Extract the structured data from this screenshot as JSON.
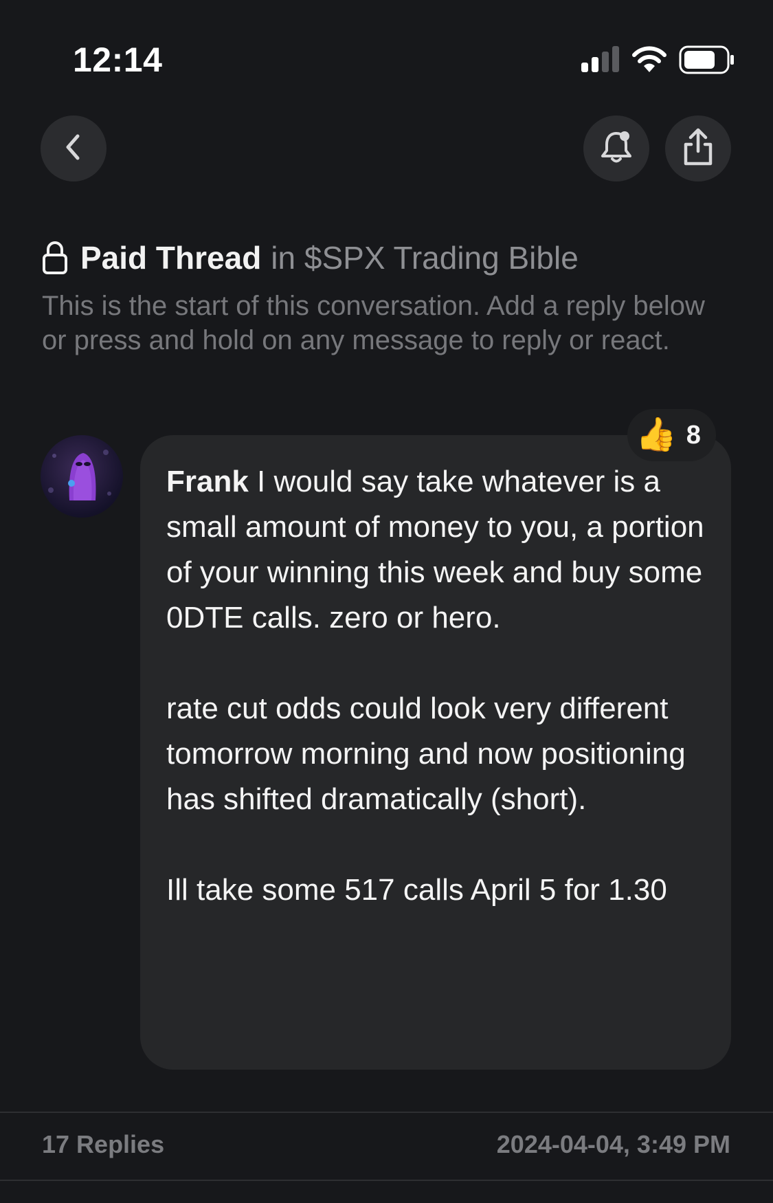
{
  "status_bar": {
    "time": "12:14",
    "icons": [
      "signal-icon",
      "wifi-icon",
      "battery-icon"
    ]
  },
  "header": {
    "back_icon": "chevron-left-icon",
    "bell_icon": "bell-icon",
    "share_icon": "share-icon"
  },
  "thread": {
    "title": "Paid Thread",
    "in_label": "in $SPX Trading Bible",
    "intro": "This is the start of this conversation. Add a reply below or press and hold on any message to reply or react."
  },
  "message": {
    "author": "Frank",
    "text": " I would say take whatever is a small amount of money to you, a portion of your winning this week and buy some 0DTE calls. zero or hero.\n\nrate cut odds could look very different tomorrow morning and now positioning has shifted dramatically (short).\n\nIll take some 517 calls April 5 for 1.30",
    "reaction": {
      "emoji": "👍",
      "count": "8"
    }
  },
  "footer": {
    "replies": "17 Replies",
    "timestamp": "2024-04-04, 3:49 PM"
  },
  "colors": {
    "background": "#17181b",
    "bubble": "#262729",
    "muted_text": "#77787c",
    "button": "#2b2c2f"
  }
}
